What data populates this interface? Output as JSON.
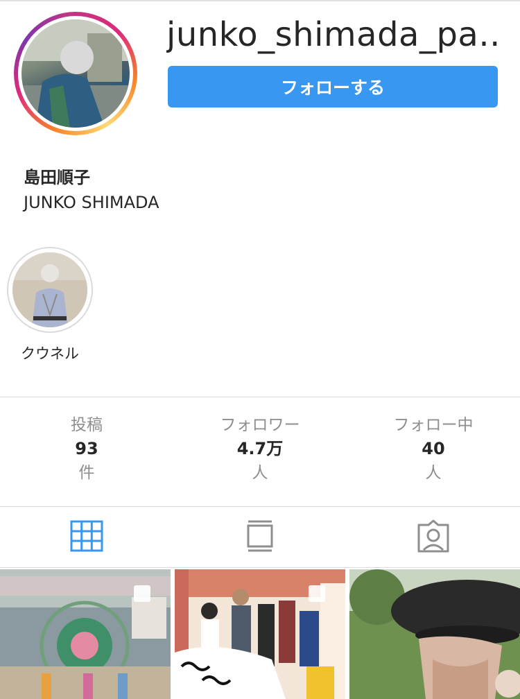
{
  "profile": {
    "username": "junko_shimada_pa...",
    "display_name": "島田順子",
    "bio": "JUNKO SHIMADA",
    "follow_label": "フォローする"
  },
  "highlights": [
    {
      "label": "クウネル"
    }
  ],
  "stats": [
    {
      "label": "投稿",
      "value": "93",
      "unit": "件"
    },
    {
      "label": "フォロワー",
      "value": "4.7万",
      "unit": "人"
    },
    {
      "label": "フォロー中",
      "value": "40",
      "unit": "人"
    }
  ],
  "tabs": [
    {
      "icon": "grid-icon",
      "active": true
    },
    {
      "icon": "feed-icon",
      "active": false
    },
    {
      "icon": "tagged-icon",
      "active": false
    }
  ],
  "posts": [
    {
      "multiple": true
    },
    {
      "multiple": true
    },
    {
      "multiple": false
    }
  ],
  "colors": {
    "accent": "#3897f0",
    "text": "#262626",
    "muted": "#8e8e8e",
    "divider": "#dbdbdb"
  }
}
